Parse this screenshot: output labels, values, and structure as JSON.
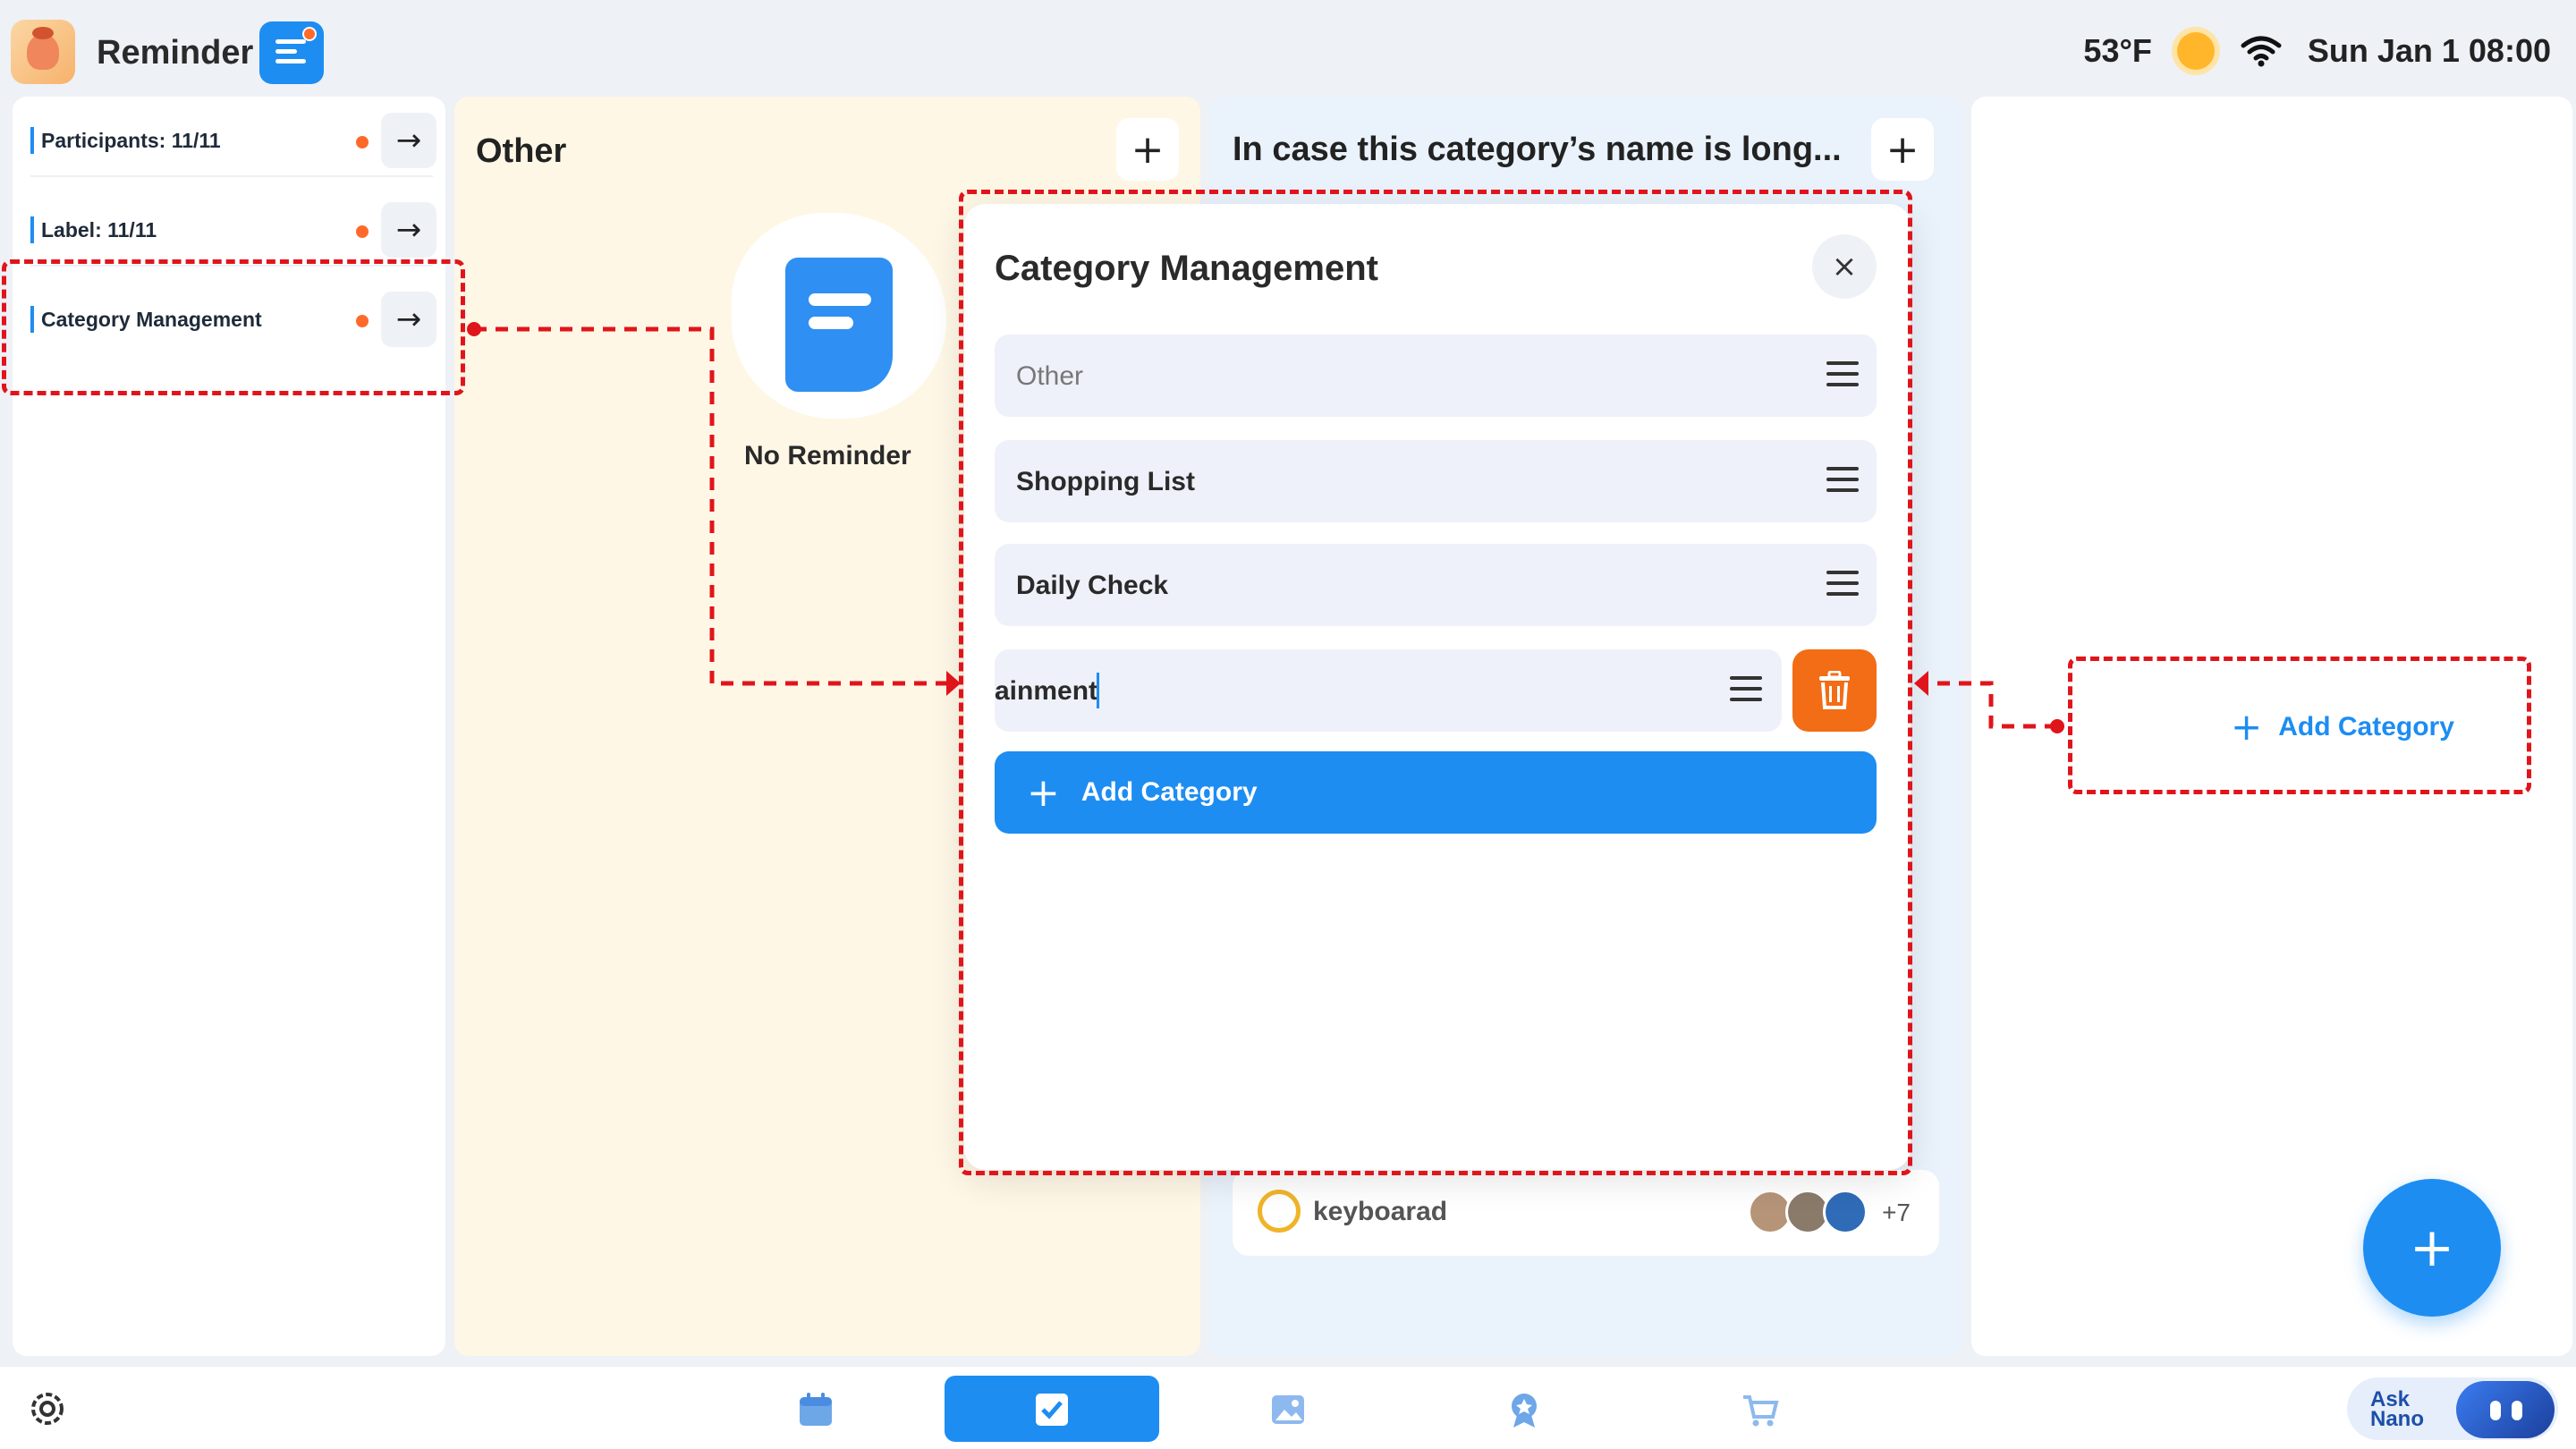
{
  "app": {
    "title": "Reminder"
  },
  "status": {
    "temperature": "53°F",
    "datetime": "Sun Jan 1 08:00"
  },
  "sidebar": {
    "items": [
      {
        "label": "Participants: 11/11"
      },
      {
        "label": "Label: 11/11"
      },
      {
        "label": "Category Management"
      }
    ]
  },
  "columns": {
    "other": {
      "title": "Other",
      "add": "+",
      "empty_text": "No Reminder"
    },
    "long": {
      "title": "In case this category’s name is long...",
      "add": "+",
      "task": {
        "name": "keyboarad",
        "more": "+7"
      }
    },
    "add_column": {
      "label": "Add Category",
      "plus": "+"
    }
  },
  "modal": {
    "title": "Category Management",
    "close": "×",
    "rows": [
      {
        "label": "Other",
        "muted": true
      },
      {
        "label": "Shopping List"
      },
      {
        "label": "Daily Check"
      }
    ],
    "editing": {
      "value": "ainment"
    },
    "add_button": {
      "label": "Add Category",
      "plus": "+"
    }
  },
  "fab": {
    "label": "+"
  },
  "bottom_nav": {
    "items": [
      "calendar-icon",
      "checkbox-icon",
      "image-icon",
      "badge-icon",
      "cart-icon"
    ],
    "active": "checkbox-icon",
    "ask_nano": {
      "line1": "Ask",
      "line2": "Nano"
    }
  },
  "colors": {
    "accent": "#1d8df2",
    "danger": "#f26d15",
    "annotation": "#e0151b",
    "other_column": "#fff7e6"
  }
}
